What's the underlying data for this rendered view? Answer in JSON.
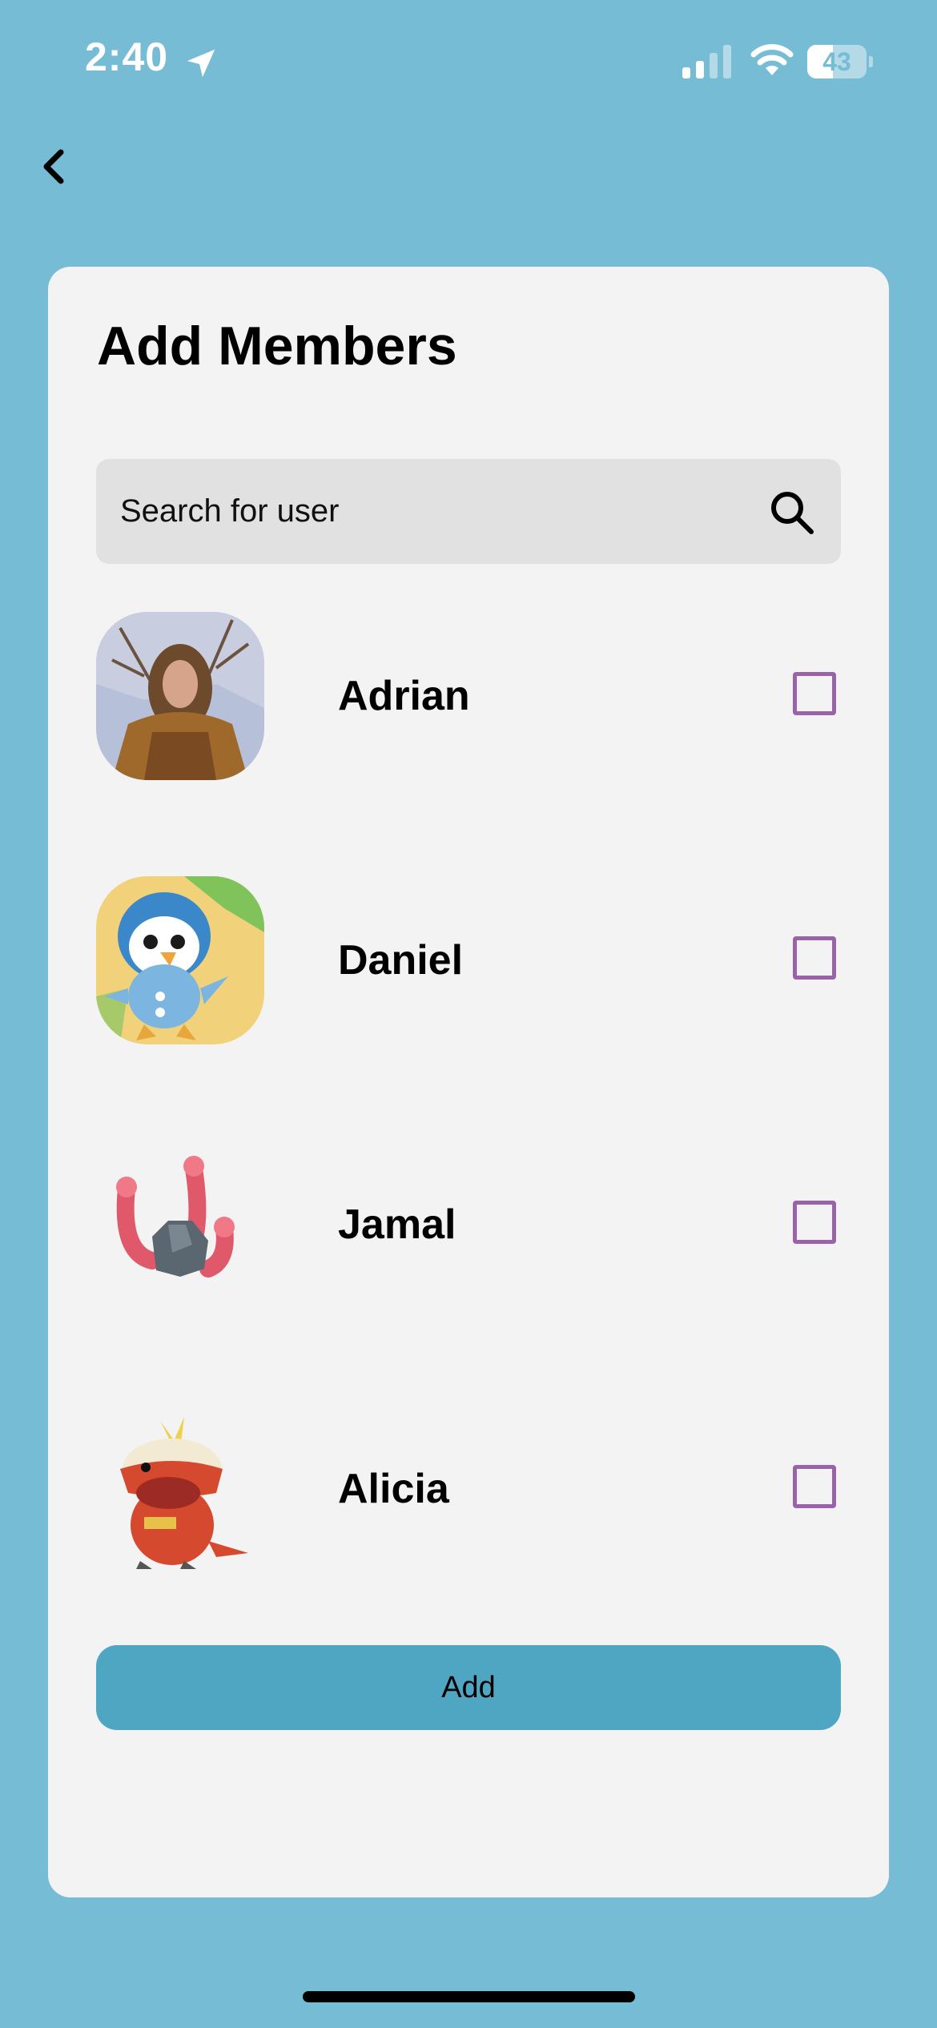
{
  "status_bar": {
    "time": "2:40",
    "battery_level": "43",
    "battery_fraction": 0.43
  },
  "icons": {
    "back": "chevron-left-icon",
    "search": "search-icon",
    "location": "location-arrow-icon",
    "signal": "cellular-signal-icon",
    "wifi": "wifi-icon"
  },
  "colors": {
    "background": "#77bcd5",
    "card": "#f3f3f3",
    "search_bg": "#e1e1e1",
    "checkbox_border": "#9a62a9",
    "add_button": "#4fa6c3"
  },
  "page": {
    "title": "Add Members"
  },
  "search": {
    "placeholder": "Search for user",
    "value": ""
  },
  "members": [
    {
      "name": "Adrian",
      "checked": false,
      "avatar": "photo-portrait"
    },
    {
      "name": "Daniel",
      "checked": false,
      "avatar": "piplup"
    },
    {
      "name": "Jamal",
      "checked": false,
      "avatar": "wiglett"
    },
    {
      "name": "Alicia",
      "checked": false,
      "avatar": "fuecoco"
    }
  ],
  "actions": {
    "add_label": "Add"
  }
}
